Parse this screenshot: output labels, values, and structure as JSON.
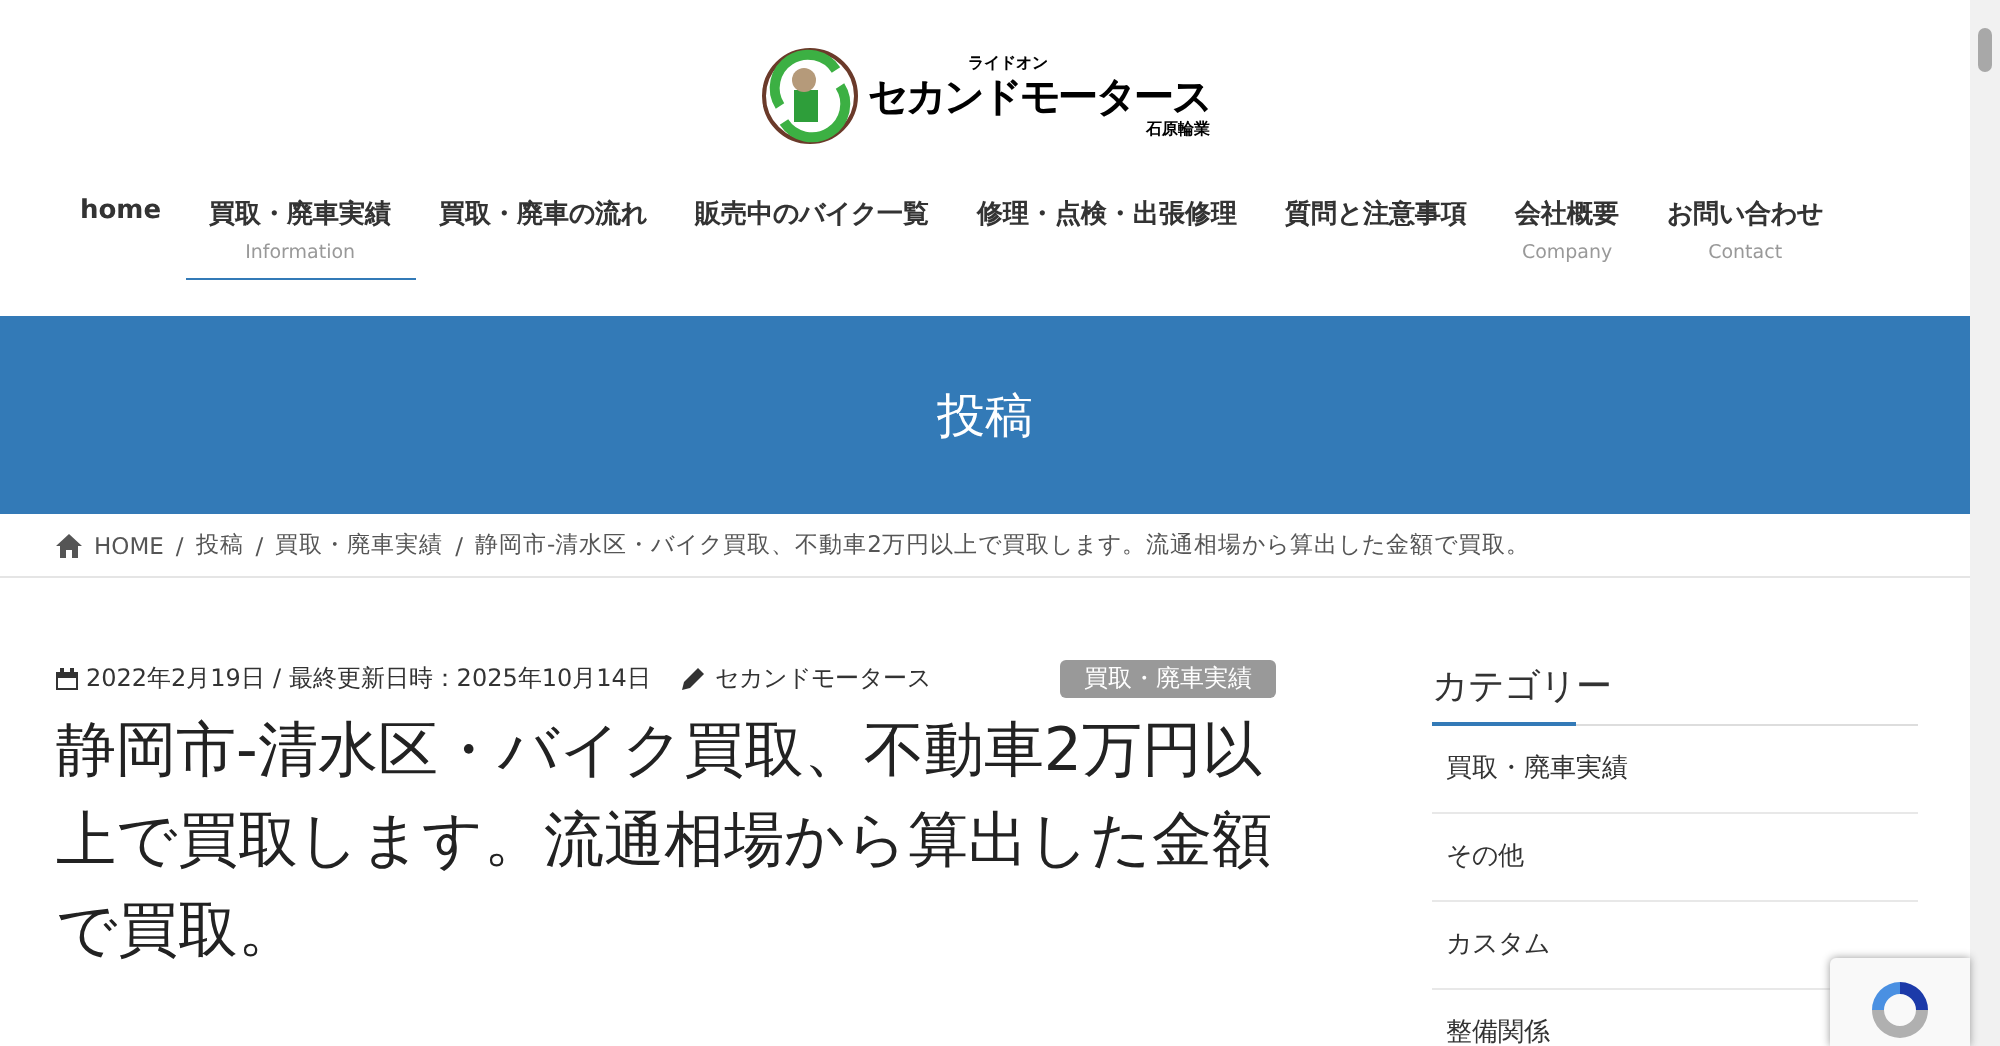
{
  "logo": {
    "small": "ライドオン",
    "main": "セカンドモータース",
    "sub": "石原輪業"
  },
  "nav": [
    {
      "label": "home",
      "selected": false
    },
    {
      "label": "買取・廃車実績",
      "sub": "Information",
      "selected": true
    },
    {
      "label": "買取・廃車の流れ",
      "selected": false
    },
    {
      "label": "販売中のバイク一覧",
      "selected": false
    },
    {
      "label": "修理・点検・出張修理",
      "selected": false
    },
    {
      "label": "質問と注意事項",
      "selected": false
    },
    {
      "label": "会社概要",
      "sub": "Company",
      "selected": false
    },
    {
      "label": "お問い合わせ",
      "sub": "Contact",
      "selected": false
    }
  ],
  "banner": {
    "title": "投稿"
  },
  "breadcrumb": [
    {
      "label": "HOME"
    },
    {
      "sep": "/",
      "label": "投稿"
    },
    {
      "sep": "/",
      "label": "買取・廃車実績"
    },
    {
      "sep": "/",
      "label": "静岡市-清水区・バイク買取、不動車2万円以上で買取します。流通相場から算出した金額で買取。"
    }
  ],
  "post": {
    "date": "2022年2月19日",
    "updated": "/ 最終更新日時：2025年10月14日",
    "author": "セカンドモータース",
    "category": "買取・廃車実績",
    "title": "静岡市-清水区・バイク買取、不動車2万円以上で買取します。流通相場から算出した金額で買取。"
  },
  "sidebar": {
    "heading": "カテゴリー",
    "items": [
      "買取・廃車実績",
      "その他",
      "カスタム",
      "整備関係"
    ]
  }
}
